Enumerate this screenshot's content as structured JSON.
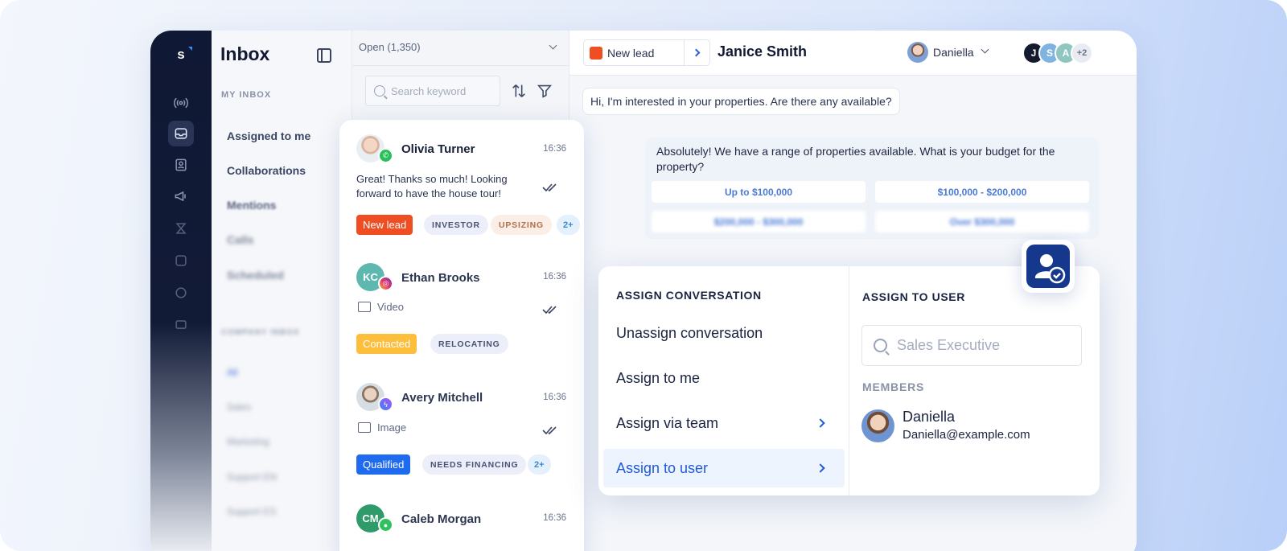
{
  "rail": {
    "logo": "s",
    "icons": [
      "broadcast-icon",
      "inbox-icon",
      "contacts-icon",
      "megaphone-icon",
      "workflow-icon",
      "reports-icon",
      "settings-icon",
      "chat-icon"
    ]
  },
  "nav": {
    "title": "Inbox",
    "section": "MY INBOX",
    "items": [
      "Assigned to me",
      "Collaborations",
      "Mentions",
      "Calls",
      "Scheduled"
    ],
    "company_section": "COMPANY INBOX",
    "company_items": [
      "All",
      "Sales",
      "Marketing",
      "Support EN",
      "Support ES"
    ]
  },
  "list": {
    "filter": "Open (1,350)",
    "search_placeholder": "Search keyword"
  },
  "conversations": [
    {
      "name": "Olivia Turner",
      "time": "16:36",
      "message": "Great! Thanks so much! Looking forward to have the house tour!",
      "channel": "whatsapp-icon",
      "tags": [
        "New lead",
        "INVESTOR",
        "UPSIZING",
        "2+"
      ]
    },
    {
      "name": "Ethan Brooks",
      "initials": "KC",
      "time": "16:36",
      "media": "Video",
      "channel": "instagram-icon",
      "tags": [
        "Contacted",
        "RELOCATING"
      ]
    },
    {
      "name": "Avery Mitchell",
      "time": "16:36",
      "media": "Image",
      "channel": "messenger-icon",
      "tags": [
        "Qualified",
        "NEEDS FINANCING",
        "2+"
      ]
    },
    {
      "name": "Caleb Morgan",
      "initials": "CM",
      "time": "16:36",
      "channel": "chat-icon"
    }
  ],
  "header": {
    "stage": "New lead",
    "contact": "Janice Smith",
    "owner": "Daniella",
    "participants": [
      "J",
      "S",
      "A"
    ],
    "participants_more": "+2"
  },
  "chat": {
    "incoming": "Hi, I'm interested in your properties. Are there any available?",
    "outgoing": "Absolutely! We have a range of properties available. What is your budget for the property?",
    "options": [
      "Up to $100,000",
      "$100,000 - $200,000",
      "$200,000 - $300,000",
      "Over $300,000"
    ]
  },
  "assign": {
    "title": "ASSIGN CONVERSATION",
    "options": [
      "Unassign conversation",
      "Assign to me",
      "Assign via team",
      "Assign to user"
    ],
    "user_title": "ASSIGN TO USER",
    "search_placeholder": "Sales Executive",
    "members_title": "MEMBERS",
    "member": {
      "name": "Daniella",
      "email": "Daniella@example.com"
    }
  },
  "colors": {
    "new_lead": "#ef4d22",
    "contacted": "#fdbe3c",
    "qualified": "#1f6bef",
    "accent": "#1f5bd6",
    "rail": "#0f1834"
  }
}
